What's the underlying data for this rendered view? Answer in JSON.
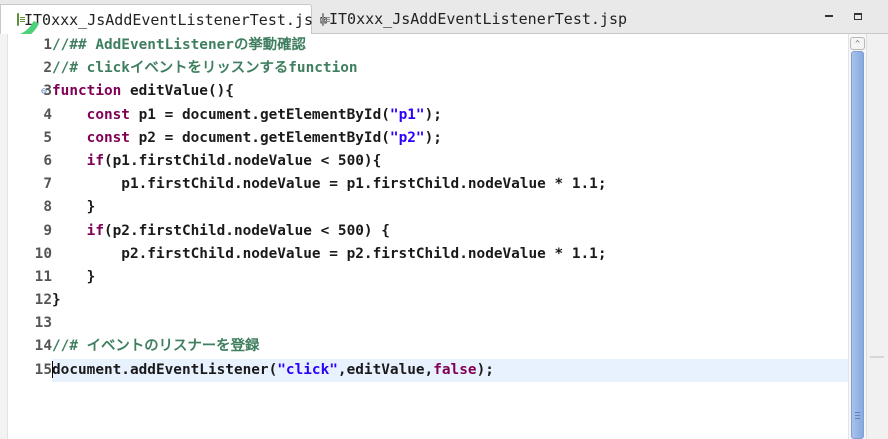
{
  "tabs": [
    {
      "label": "IT0xxx_JsAddEventListenerTest.js",
      "close": "⊠",
      "active": true,
      "icon": "js-file-icon"
    },
    {
      "label": "IT0xxx_JsAddEventListenerTest.jsp",
      "active": false,
      "icon": "jsp-file-icon"
    }
  ],
  "window": {
    "minimize": "minimize-icon",
    "maximize": "maximize-icon"
  },
  "editor": {
    "line_numbers": [
      "1",
      "2",
      "3",
      "4",
      "5",
      "6",
      "7",
      "8",
      "9",
      "10",
      "11",
      "12",
      "13",
      "14",
      "15"
    ],
    "fold_marker": "⊖",
    "current_line": 15,
    "colors": {
      "comment": "#3f7f5f",
      "keyword": "#7f0055",
      "string": "#2a00ff",
      "current_line": "#e8f2fe",
      "scroll_thumb": "#86a9de"
    },
    "lines": [
      [
        {
          "t": "//## AddEventListenerの挙動確認",
          "c": "cm"
        }
      ],
      [
        {
          "t": "//# clickイベントをリッスンするfunction",
          "c": "cm"
        }
      ],
      [
        {
          "t": "function",
          "c": "kw"
        },
        {
          "t": " editValue(){",
          "c": ""
        }
      ],
      [
        {
          "t": "    ",
          "c": ""
        },
        {
          "t": "const",
          "c": "kw"
        },
        {
          "t": " p1 = document.getElementById(",
          "c": ""
        },
        {
          "t": "\"p1\"",
          "c": "str"
        },
        {
          "t": ");",
          "c": ""
        }
      ],
      [
        {
          "t": "    ",
          "c": ""
        },
        {
          "t": "const",
          "c": "kw"
        },
        {
          "t": " p2 = document.getElementById(",
          "c": ""
        },
        {
          "t": "\"p2\"",
          "c": "str"
        },
        {
          "t": ");",
          "c": ""
        }
      ],
      [
        {
          "t": "    ",
          "c": ""
        },
        {
          "t": "if",
          "c": "kw"
        },
        {
          "t": "(p1.firstChild.nodeValue < 500){",
          "c": ""
        }
      ],
      [
        {
          "t": "        p1.firstChild.nodeValue = p1.firstChild.nodeValue * 1.1;",
          "c": ""
        }
      ],
      [
        {
          "t": "    }",
          "c": ""
        }
      ],
      [
        {
          "t": "    ",
          "c": ""
        },
        {
          "t": "if",
          "c": "kw"
        },
        {
          "t": "(p2.firstChild.nodeValue < 500) {",
          "c": ""
        }
      ],
      [
        {
          "t": "        p2.firstChild.nodeValue = p2.firstChild.nodeValue * 1.1;",
          "c": ""
        }
      ],
      [
        {
          "t": "    }",
          "c": ""
        }
      ],
      [
        {
          "t": "}",
          "c": ""
        }
      ],
      [],
      [
        {
          "t": "//# イベントのリスナーを登録",
          "c": "cm"
        }
      ],
      [
        {
          "t": "document.addEventListener(",
          "c": ""
        },
        {
          "t": "\"click\"",
          "c": "str"
        },
        {
          "t": ",editValue,",
          "c": ""
        },
        {
          "t": "false",
          "c": "kw"
        },
        {
          "t": ");",
          "c": ""
        }
      ]
    ]
  },
  "scrollbar": {
    "up_arrow": "^"
  }
}
